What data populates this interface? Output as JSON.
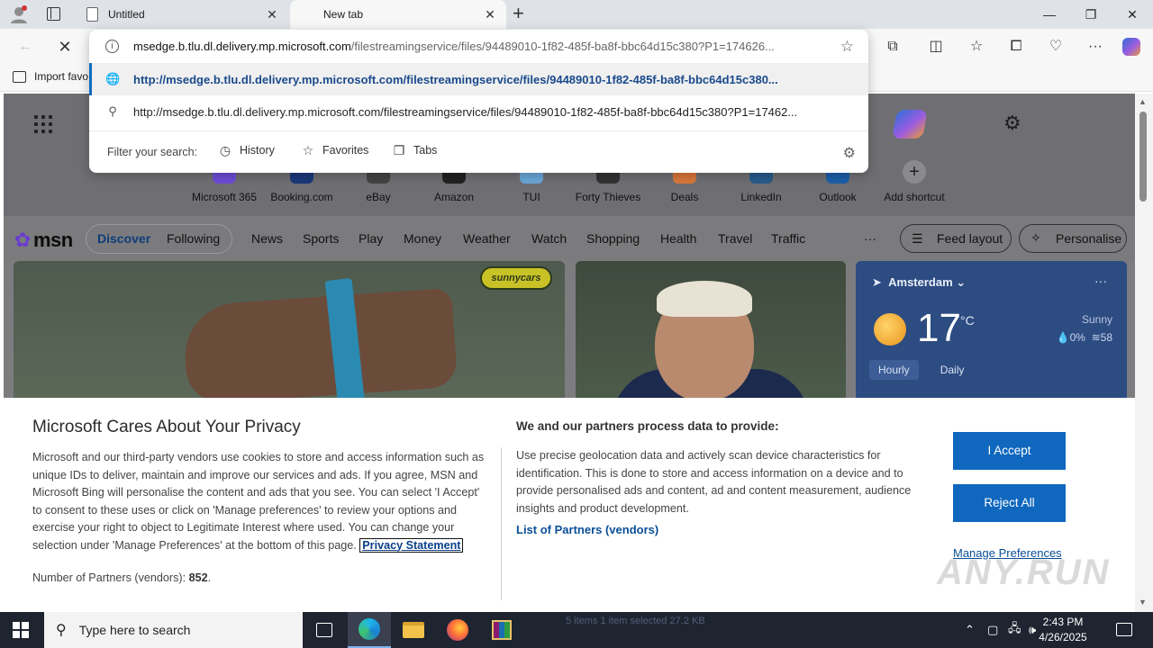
{
  "browser": {
    "tabs": [
      {
        "label": "Untitled"
      },
      {
        "label": "New tab"
      }
    ],
    "favorites_bar": {
      "import_label": "Import favo"
    },
    "omnibox": {
      "url_domain": "msedge.b.tlu.dl.delivery.mp.microsoft.com",
      "url_path": "/filestreamingservice/files/94489010-1f82-485f-ba8f-bbc64d15c380?P1=174626...",
      "suggestion_selected": "http://msedge.b.tlu.dl.delivery.mp.microsoft.com/filestreamingservice/files/94489010-1f82-485f-ba8f-bbc64d15c380...",
      "suggestion_search": "http://msedge.b.tlu.dl.delivery.mp.microsoft.com/filestreamingservice/files/94489010-1f82-485f-ba8f-bbc64d15c380?P1=17462...",
      "filter_label": "Filter your search:",
      "filters": [
        {
          "label": "History",
          "icon": "history-icon"
        },
        {
          "label": "Favorites",
          "icon": "star-icon"
        },
        {
          "label": "Tabs",
          "icon": "tabs-icon"
        }
      ]
    }
  },
  "newtab": {
    "shortcuts": [
      {
        "label": "Microsoft 365",
        "color": "#6d4cd6"
      },
      {
        "label": "Booking.com",
        "color": "#1b3a7a"
      },
      {
        "label": "eBay",
        "color": "#444444"
      },
      {
        "label": "Amazon",
        "color": "#222222"
      },
      {
        "label": "TUI",
        "color": "#6aa7d8"
      },
      {
        "label": "Forty Thieves",
        "color": "#333333"
      },
      {
        "label": "Deals",
        "color": "#d9773a"
      },
      {
        "label": "LinkedIn",
        "color": "#2a5b8a"
      },
      {
        "label": "Outlook",
        "color": "#1d5fa8"
      },
      {
        "label": "Add shortcut",
        "color": "#8a8a8d"
      }
    ],
    "msn": {
      "logo": "msn",
      "tabs": [
        {
          "label": "Discover"
        },
        {
          "label": "Following"
        }
      ],
      "nav": [
        "News",
        "Sports",
        "Play",
        "Money",
        "Weather",
        "Watch",
        "Shopping",
        "Health",
        "Travel",
        "Traffic"
      ],
      "more": "···",
      "feed_layout": "Feed layout",
      "personalise": "Personalise"
    },
    "card1_badge": "sunnycars",
    "weather": {
      "location": "Amsterdam",
      "temp": "17",
      "unit": "°C",
      "condition": "Sunny",
      "precip": "0%",
      "wind": "58",
      "tabs": [
        "Hourly",
        "Daily"
      ],
      "more": "···"
    }
  },
  "privacy": {
    "title": "Microsoft Cares About Your Privacy",
    "body": "Microsoft and our third-party vendors use cookies to store and access information such as unique IDs to deliver, maintain and improve our services and ads. If you agree, MSN and Microsoft Bing will personalise the content and ads that you see. You can select 'I Accept' to consent to these uses or click on 'Manage preferences' to review your options and exercise your right to object to Legitimate Interest where used.  You can change your selection under 'Manage Preferences' at the bottom of this page.",
    "statement_link": "Privacy Statement",
    "partners_label": "Number of Partners (vendors):",
    "partners_count": "852",
    "heading2": "We and our partners process data to provide:",
    "body2": "Use precise geolocation data and actively scan device characteristics for identification. This is done to store and access information on a device and to provide personalised ads and content, ad and content measurement, audience insights and product development.",
    "vendors_link": "List of Partners (vendors)",
    "accept": "I Accept",
    "reject": "Reject All",
    "manage": "Manage Preferences"
  },
  "watermark": "ANY.RUN",
  "taskbar": {
    "search_placeholder": "Type here to search",
    "behind_text": "5 items     1 item selected  27.2 KB",
    "time": "2:43 PM",
    "date": "4/26/2025"
  }
}
